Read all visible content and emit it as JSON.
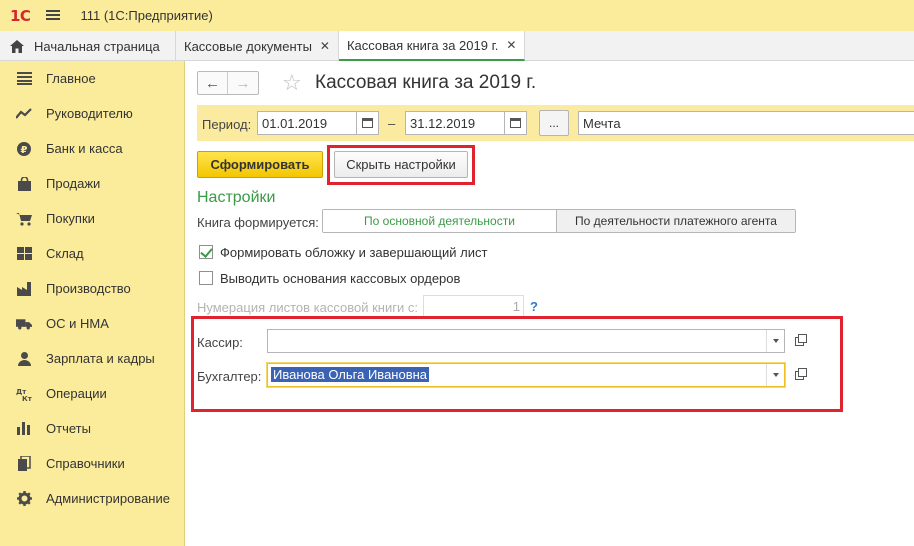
{
  "app": {
    "logo": "1С",
    "title": "111  (1С:Предприятие)"
  },
  "tabs": [
    {
      "label": "Начальная страница"
    },
    {
      "label": "Кассовые документы"
    },
    {
      "label": "Кассовая книга за 2019 г."
    }
  ],
  "sidebar": {
    "items": [
      {
        "label": "Главное",
        "icon": "menu-lines-icon"
      },
      {
        "label": "Руководителю",
        "icon": "trend-chart-icon"
      },
      {
        "label": "Банк и касса",
        "icon": "coin-icon"
      },
      {
        "label": "Продажи",
        "icon": "shopping-bag-icon"
      },
      {
        "label": "Покупки",
        "icon": "cart-icon"
      },
      {
        "label": "Склад",
        "icon": "warehouse-grid-icon"
      },
      {
        "label": "Производство",
        "icon": "factory-icon"
      },
      {
        "label": "ОС и НМА",
        "icon": "truck-icon"
      },
      {
        "label": "Зарплата и кадры",
        "icon": "person-icon"
      },
      {
        "label": "Операции",
        "icon": "debit-credit-icon"
      },
      {
        "label": "Отчеты",
        "icon": "bar-chart-icon"
      },
      {
        "label": "Справочники",
        "icon": "books-icon"
      },
      {
        "label": "Администрирование",
        "icon": "gear-icon"
      }
    ]
  },
  "page": {
    "title": "Кассовая книга за 2019 г.",
    "period_label": "Период:",
    "date_from": "01.01.2019",
    "date_to": "31.12.2019",
    "dash": "–",
    "dots": "...",
    "organization": "Мечта",
    "generate_label": "Сформировать",
    "hide_settings_label": "Скрыть настройки",
    "settings_title": "Настройки",
    "book_label": "Книга формируется:",
    "seg_main": "По основной деятельности",
    "seg_agent": "По деятельности платежного агента",
    "chk_cover": "Формировать обложку и завершающий лист",
    "chk_cover_checked": true,
    "chk_basis": "Выводить основания кассовых ордеров",
    "chk_basis_checked": false,
    "numbering_label": "Нумерация листов кассовой книги с:",
    "numbering_value": "1",
    "help": "?",
    "cashier_label": "Кассир:",
    "cashier_value": "",
    "accountant_label": "Бухгалтер:",
    "accountant_value": "Иванова Ольга Ивановна"
  },
  "colors": {
    "accent_yellow": "#fbec9c",
    "green": "#3a9b46",
    "highlight_red": "#e0232e"
  }
}
